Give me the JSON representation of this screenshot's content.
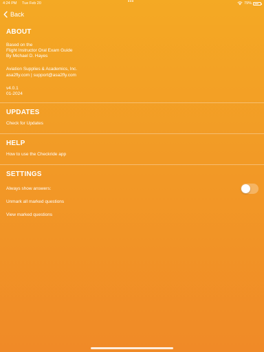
{
  "status_bar": {
    "time": "4:24 PM",
    "date": "Tue Feb 20",
    "dots": "•••",
    "battery_text": "79%",
    "battery_level": 0.79
  },
  "nav": {
    "back_label": "Back"
  },
  "about": {
    "title": "ABOUT",
    "lines": [
      "Based on the",
      "Flight Instructor Oral Exam Guide",
      "By Michael D. Hayes",
      "Aviation Supplies & Academics, Inc.",
      "asa2fly.com | support@asa2fly.com",
      "v4.0.1",
      "01-2024"
    ]
  },
  "updates": {
    "title": "UPDATES",
    "check_label": "Check for Updates"
  },
  "help": {
    "title": "HELP",
    "howto_label": "How to use the Checkride app"
  },
  "settings": {
    "title": "SETTINGS",
    "always_show_label": "Always show answers:",
    "always_show_value": false,
    "unmark_label": "Unmark all marked questions",
    "view_marked_label": "View marked questions"
  }
}
